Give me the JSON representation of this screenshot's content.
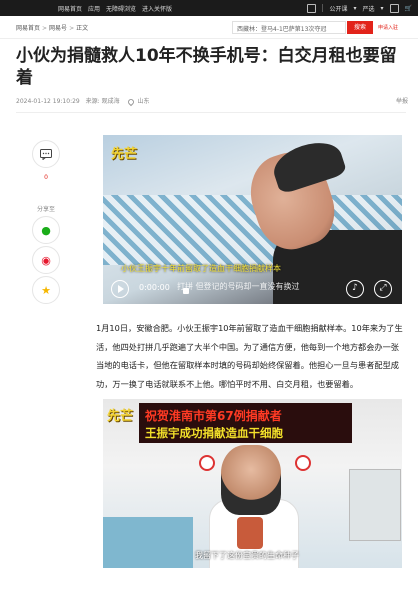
{
  "topbar": {
    "links": [
      "网易首页",
      "应用",
      "无障碍浏览",
      "进入关怀版"
    ],
    "user": "公开课",
    "user_menu": "严选"
  },
  "nav": {
    "breadcrumb": [
      "网易首页",
      "网易号",
      "正文"
    ],
    "search_placeholder": "西藏林：登马4-1巴萨第13次夺冠",
    "search_button": "搜索",
    "apply_link": "申请入驻"
  },
  "article": {
    "title": "小伙为捐髓救人10年不换手机号：白交月租也要留着",
    "date": "2024-01-12 19:10:29",
    "source": "来源: 观成海",
    "location": "山东",
    "report": "举报",
    "comment_count": "0",
    "share_label": "分享至",
    "paragraph": "1月10日，安徽合肥。小伙王振宇10年前留取了造血干细胞捐献样本。10年来为了生活，他四处打拼几乎跑遍了大半个中国。为了通信方便，他每到一个地方都会办一张当地的电话卡，但他在留取样本时填的号码却始终保留着。他担心一旦与患者配型成功，万一换了电话就联系不上他。哪怕平时不用、白交月租，也要留着。"
  },
  "video": {
    "logo": "先芒",
    "subtitle_top": "小伙王振宇十年前留取了造血干细胞捐献样本",
    "subtitle_bottom": "打拼 但登记的号码却一直没有换过",
    "time": "0:00:00"
  },
  "photo": {
    "logo": "先芒",
    "led_line1": "祝贺淮南市第67例捐献者",
    "led_line2": "王振宇成功捐献造血干细胞",
    "caption": "我留下了这份宝贵的生命种子"
  }
}
